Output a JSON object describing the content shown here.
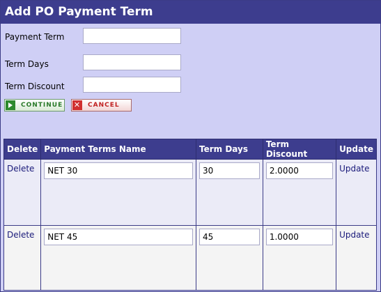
{
  "title": "Add PO Payment Term",
  "form": {
    "payment_term_label": "Payment Term",
    "payment_term_value": "",
    "term_days_label": "Term Days",
    "term_days_value": "",
    "term_discount_label": "Term Discount",
    "term_discount_value": ""
  },
  "buttons": {
    "continue_label": "CONTINUE",
    "cancel_label": "CANCEL",
    "cancel_icon": "x-icon"
  },
  "table": {
    "headers": [
      "Delete",
      "Payment Terms Name",
      "Term Days",
      "Term Discount",
      "Update"
    ],
    "rows": [
      {
        "delete": "Delete",
        "name": "NET 30",
        "days": "30",
        "discount": "2.0000",
        "update": "Update"
      },
      {
        "delete": "Delete",
        "name": "NET 45",
        "days": "45",
        "discount": "1.0000",
        "update": "Update"
      }
    ]
  },
  "colors": {
    "header_bg": "#3d3d8e",
    "panel_bg": "#cfcff5",
    "link": "#1a1a7a"
  }
}
